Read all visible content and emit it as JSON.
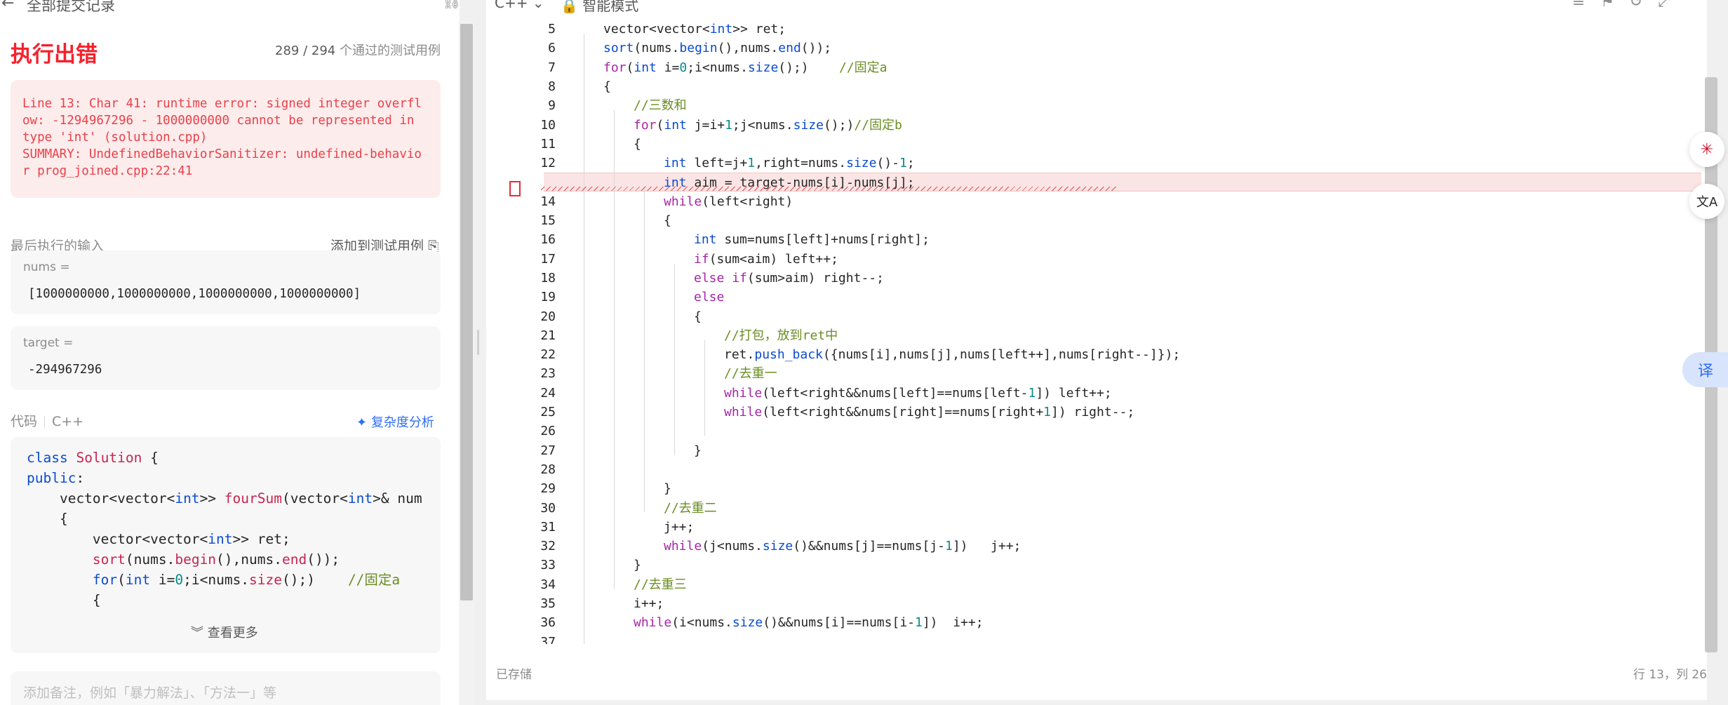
{
  "left": {
    "header_title": "全部提交记录",
    "result_title": "执行出错",
    "pass_count": "289 / 294",
    "pass_suffix": "个通过的测试用例",
    "error_message": "Line 13: Char 41: runtime error: signed integer overflow: -1294967296 - 1000000000 cannot be represented in type 'int' (solution.cpp)\nSUMMARY: UndefinedBehaviorSanitizer: undefined-behavior prog_joined.cpp:22:41",
    "last_input_label": "最后执行的输入",
    "add_testcase": "添加到测试用例",
    "inputs": [
      {
        "name": "nums =",
        "value": "[1000000000,1000000000,1000000000,1000000000]"
      },
      {
        "name": "target =",
        "value": "-294967296"
      }
    ],
    "code_label": "代码",
    "code_lang": "C++",
    "complexity": "复杂度分析",
    "code_preview": [
      "class Solution {",
      "public:",
      "    vector<vector<int>> fourSum(vector<int>& num",
      "    {",
      "        vector<vector<int>> ret;",
      "        sort(nums.begin(),nums.end());",
      "        for(int i=0;i<nums.size();)    //固定a",
      "        {"
    ],
    "view_more": "查看更多",
    "note_placeholder": "添加备注，例如「暴力解法」、「方法一」等"
  },
  "editor": {
    "language": "C++",
    "mode": "智能模式",
    "saved": "已存储",
    "cursor_pos": "行 13，列 26",
    "lines": [
      {
        "n": "5",
        "indent": 1,
        "code": "vector<vector<int>> ret;"
      },
      {
        "n": "6",
        "indent": 1,
        "code": "sort(nums.begin(),nums.end());"
      },
      {
        "n": "7",
        "indent": 1,
        "code": "for(int i=0;i<nums.size();)    //固定a"
      },
      {
        "n": "8",
        "indent": 1,
        "code": "{"
      },
      {
        "n": "9",
        "indent": 2,
        "code": "//三数和"
      },
      {
        "n": "10",
        "indent": 2,
        "code": "for(int j=i+1;j<nums.size();)//固定b"
      },
      {
        "n": "11",
        "indent": 2,
        "code": "{"
      },
      {
        "n": "12",
        "indent": 3,
        "code": "int left=j+1,right=nums.size()-1;"
      },
      {
        "n": "13",
        "indent": 3,
        "code": "int aim = target-nums[i]-nums[j];",
        "error": true
      },
      {
        "n": "14",
        "indent": 3,
        "code": "while(left<right)"
      },
      {
        "n": "15",
        "indent": 3,
        "code": "{"
      },
      {
        "n": "16",
        "indent": 4,
        "code": "int sum=nums[left]+nums[right];"
      },
      {
        "n": "17",
        "indent": 4,
        "code": "if(sum<aim) left++;"
      },
      {
        "n": "18",
        "indent": 4,
        "code": "else if(sum>aim) right--;"
      },
      {
        "n": "19",
        "indent": 4,
        "code": "else"
      },
      {
        "n": "20",
        "indent": 4,
        "code": "{"
      },
      {
        "n": "21",
        "indent": 5,
        "code": "//打包，放到ret中"
      },
      {
        "n": "22",
        "indent": 5,
        "code": "ret.push_back({nums[i],nums[j],nums[left++],nums[right--]});"
      },
      {
        "n": "23",
        "indent": 5,
        "code": "//去重一"
      },
      {
        "n": "24",
        "indent": 5,
        "code": "while(left<right&&nums[left]==nums[left-1]) left++;"
      },
      {
        "n": "25",
        "indent": 5,
        "code": "while(left<right&&nums[right]==nums[right+1]) right--;"
      },
      {
        "n": "26",
        "indent": 5,
        "code": ""
      },
      {
        "n": "27",
        "indent": 4,
        "code": "}"
      },
      {
        "n": "28",
        "indent": 4,
        "code": ""
      },
      {
        "n": "29",
        "indent": 3,
        "code": "}"
      },
      {
        "n": "30",
        "indent": 3,
        "code": "//去重二"
      },
      {
        "n": "31",
        "indent": 3,
        "code": "j++;"
      },
      {
        "n": "32",
        "indent": 3,
        "code": "while(j<nums.size()&&nums[j]==nums[j-1])   j++;"
      },
      {
        "n": "33",
        "indent": 2,
        "code": "}"
      },
      {
        "n": "34",
        "indent": 2,
        "code": "//去重三"
      },
      {
        "n": "35",
        "indent": 2,
        "code": "i++;"
      },
      {
        "n": "36",
        "indent": 2,
        "code": "while(i<nums.size()&&nums[i]==nums[i-1])  i++;"
      },
      {
        "n": "37",
        "indent": 1,
        "code": ""
      }
    ]
  },
  "floating": {
    "translate_label": "译",
    "lang_toggle": "文A"
  },
  "colors": {
    "error": "#f5222d",
    "accent": "#2f6df6",
    "error_bg": "#fdecec"
  }
}
